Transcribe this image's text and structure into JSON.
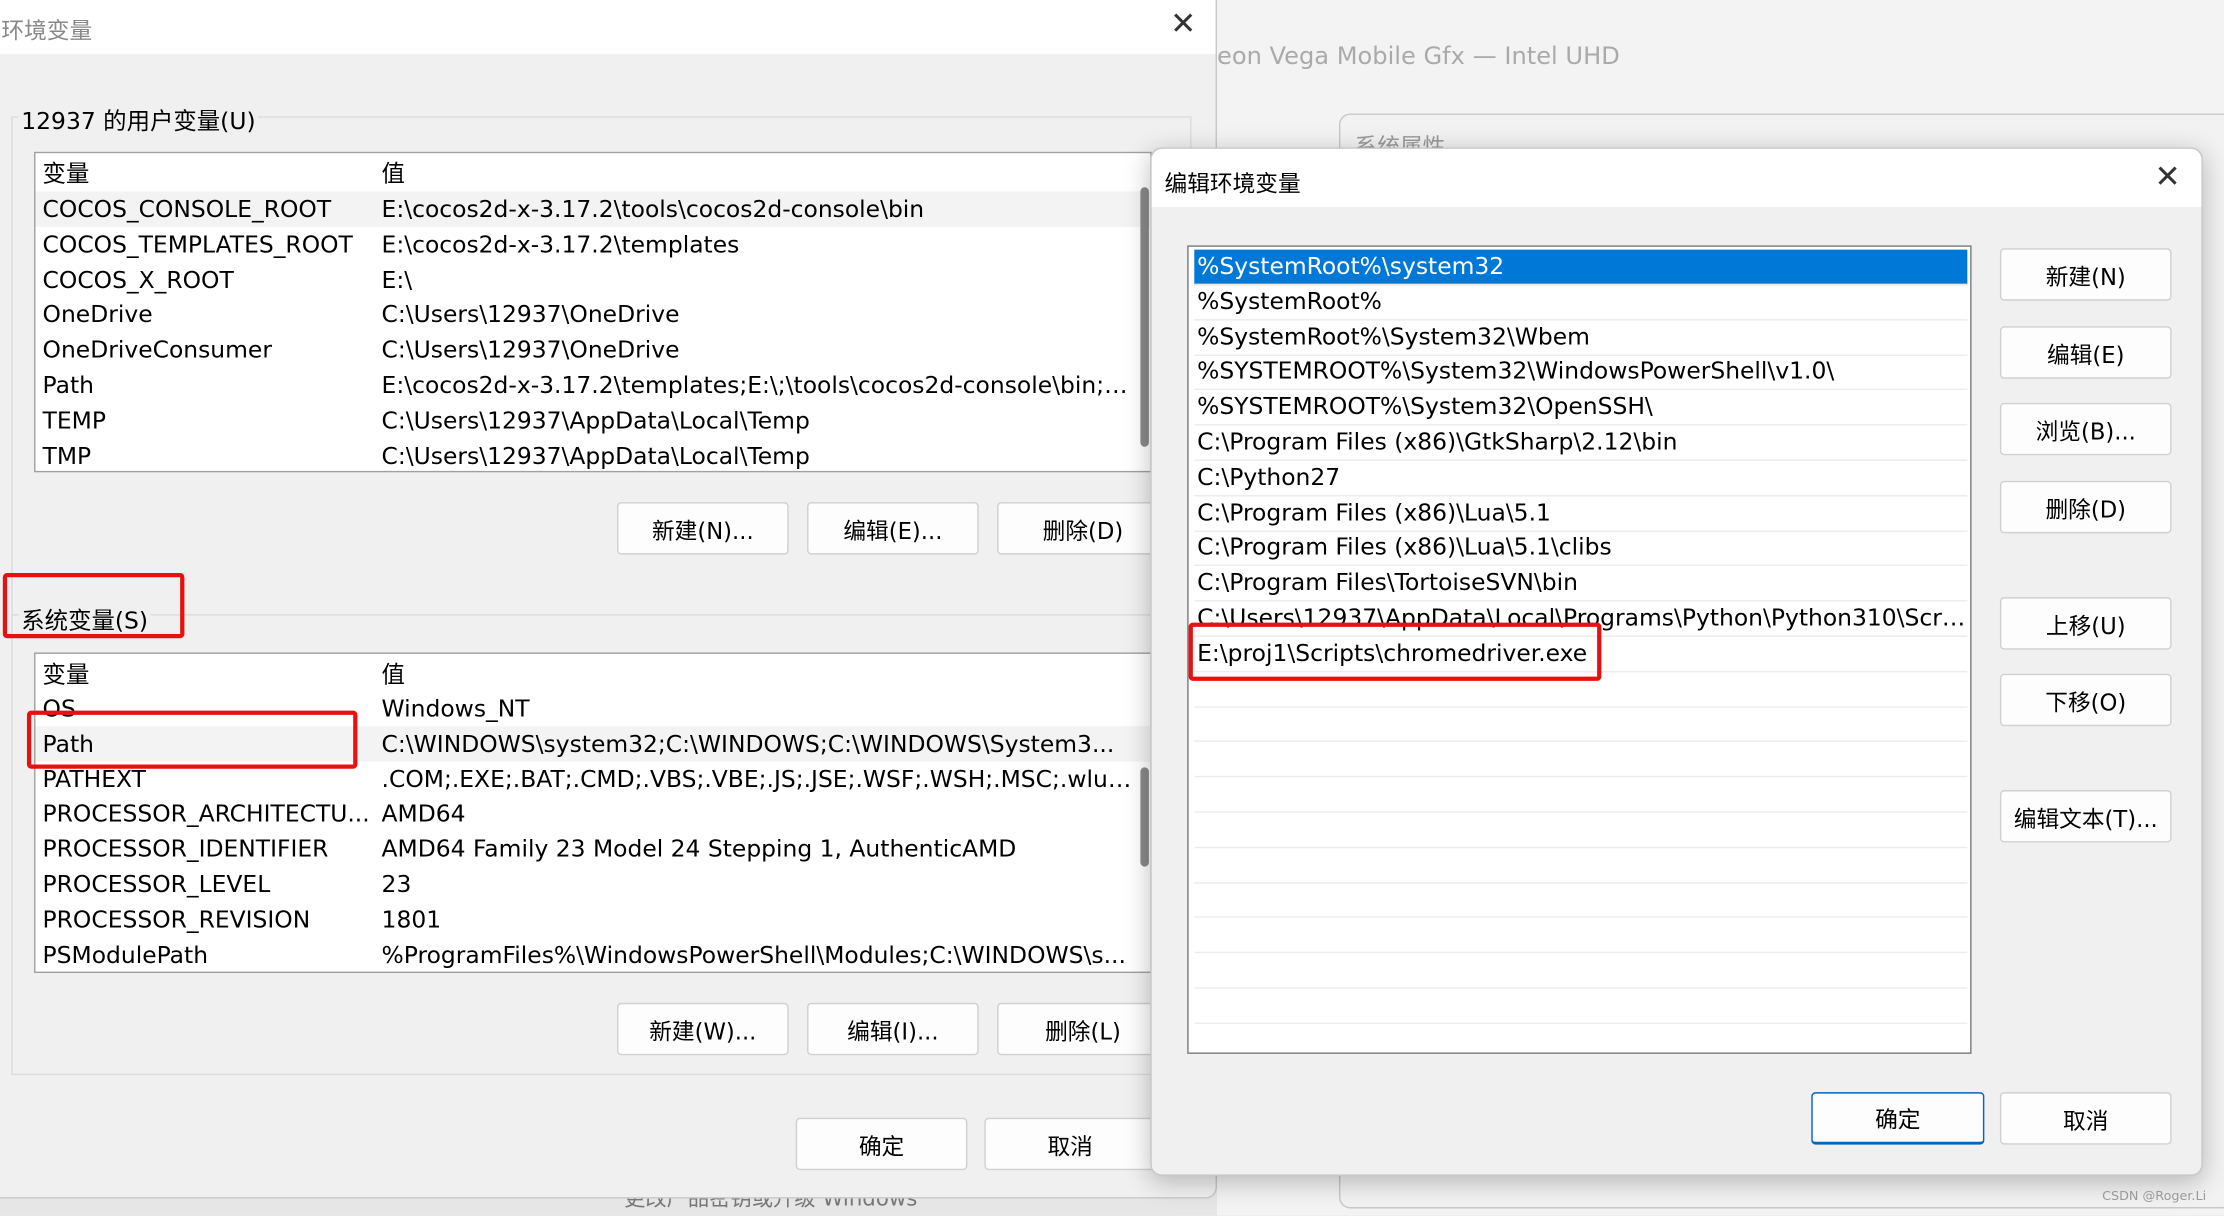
{
  "background": {
    "window_text": "eon Vega Mobile Gfx — Intel UHD",
    "sysprops_title": "系统属性",
    "bottom_text": "更改产品密钥或升级 Windows",
    "watermark": "CSDN @Roger.Li"
  },
  "env_dialog": {
    "title": "环境变量",
    "user_group": "12937 的用户变量(U)",
    "columns": [
      "变量",
      "值"
    ],
    "user_vars": [
      [
        "COCOS_CONSOLE_ROOT",
        "E:\\cocos2d-x-3.17.2\\tools\\cocos2d-console\\bin"
      ],
      [
        "COCOS_TEMPLATES_ROOT",
        "E:\\cocos2d-x-3.17.2\\templates"
      ],
      [
        "COCOS_X_ROOT",
        "E:\\"
      ],
      [
        "OneDrive",
        "C:\\Users\\12937\\OneDrive"
      ],
      [
        "OneDriveConsumer",
        "C:\\Users\\12937\\OneDrive"
      ],
      [
        "Path",
        "E:\\cocos2d-x-3.17.2\\templates;E:\\;\\tools\\cocos2d-console\\bin;\\..."
      ],
      [
        "TEMP",
        "C:\\Users\\12937\\AppData\\Local\\Temp"
      ],
      [
        "TMP",
        "C:\\Users\\12937\\AppData\\Local\\Temp"
      ]
    ],
    "user_buttons": [
      "新建(N)...",
      "编辑(E)...",
      "删除(D)"
    ],
    "sys_group": "系统变量(S)",
    "sys_vars": [
      [
        "OS",
        "Windows_NT"
      ],
      [
        "Path",
        "C:\\WINDOWS\\system32;C:\\WINDOWS;C:\\WINDOWS\\System3..."
      ],
      [
        "PATHEXT",
        ".COM;.EXE;.BAT;.CMD;.VBS;.VBE;.JS;.JSE;.WSF;.WSH;.MSC;.wlua;.l..."
      ],
      [
        "PROCESSOR_ARCHITECTU...",
        "AMD64"
      ],
      [
        "PROCESSOR_IDENTIFIER",
        "AMD64 Family 23 Model 24 Stepping 1, AuthenticAMD"
      ],
      [
        "PROCESSOR_LEVEL",
        "23"
      ],
      [
        "PROCESSOR_REVISION",
        "1801"
      ],
      [
        "PSModulePath",
        "%ProgramFiles%\\WindowsPowerShell\\Modules;C:\\WINDOWS\\s..."
      ]
    ],
    "sys_buttons": [
      "新建(W)...",
      "编辑(I)...",
      "删除(L)"
    ],
    "ok": "确定",
    "cancel": "取消"
  },
  "edit_dialog": {
    "title": "编辑环境变量",
    "items": [
      "%SystemRoot%\\system32",
      "%SystemRoot%",
      "%SystemRoot%\\System32\\Wbem",
      "%SYSTEMROOT%\\System32\\WindowsPowerShell\\v1.0\\",
      "%SYSTEMROOT%\\System32\\OpenSSH\\",
      "C:\\Program Files (x86)\\GtkSharp\\2.12\\bin",
      "C:\\Python27",
      "C:\\Program Files (x86)\\Lua\\5.1",
      "C:\\Program Files (x86)\\Lua\\5.1\\clibs",
      "C:\\Program Files\\TortoiseSVN\\bin",
      "C:\\Users\\12937\\AppData\\Local\\Programs\\Python\\Python310\\Scri...",
      "E:\\proj1\\Scripts\\chromedriver.exe"
    ],
    "selected_index": 0,
    "buttons": [
      "新建(N)",
      "编辑(E)",
      "浏览(B)...",
      "删除(D)",
      "上移(U)",
      "下移(O)",
      "编辑文本(T)..."
    ],
    "ok": "确定",
    "cancel": "取消"
  },
  "colors": {
    "selection": "#0078d7",
    "highlight_box": "#e81010"
  }
}
